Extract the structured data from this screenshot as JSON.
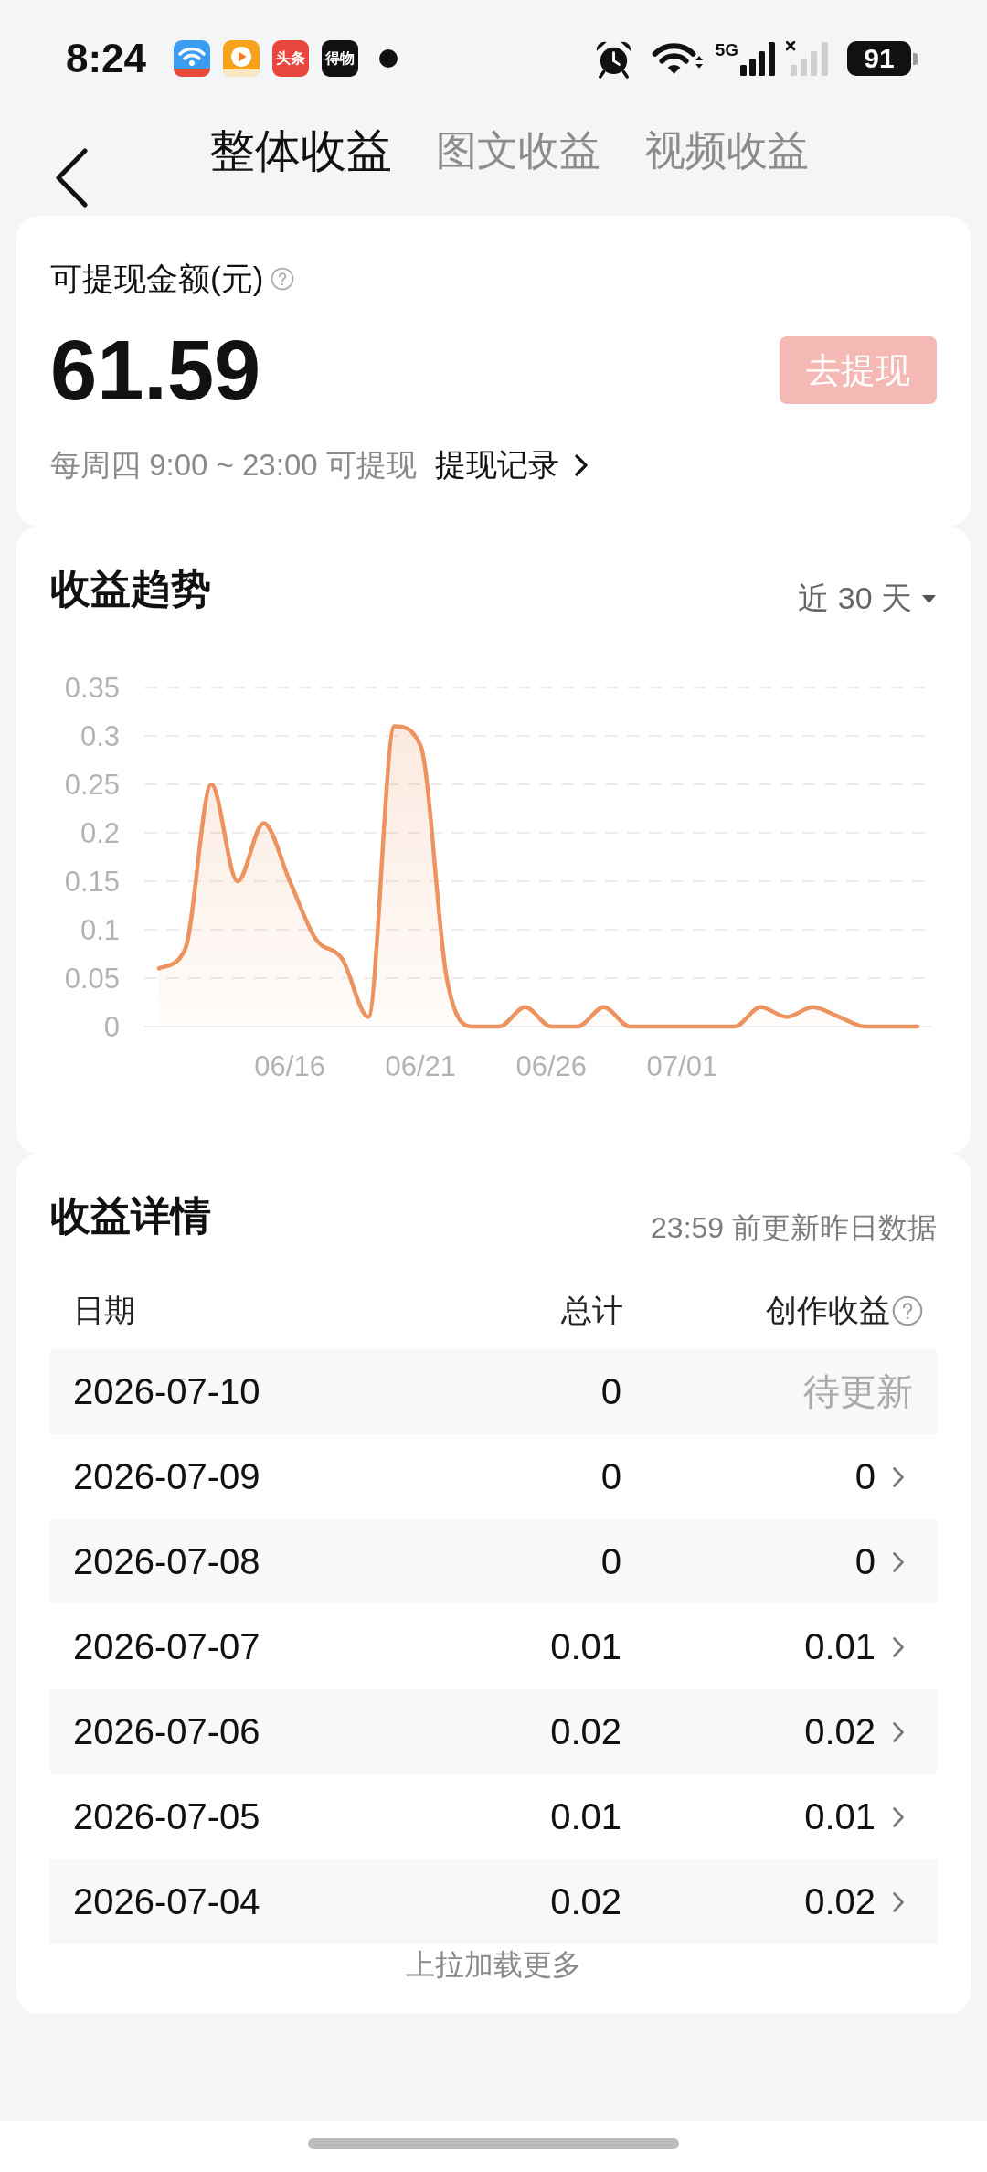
{
  "status_bar": {
    "time": "8:24",
    "app_badges": [
      {
        "label": "头条",
        "color": "#e8463d"
      },
      {
        "label": "得物",
        "color": "#111111"
      }
    ],
    "network": "5G",
    "battery": "91"
  },
  "tabs": [
    {
      "label": "整体收益",
      "selected": true
    },
    {
      "label": "图文收益",
      "selected": false
    },
    {
      "label": "视频收益",
      "selected": false
    }
  ],
  "balance_card": {
    "label": "可提现金额(元)",
    "amount": "61.59",
    "withdraw_button": {
      "label": "去提现",
      "disabled": true
    },
    "schedule": "每周四 9:00 ~ 23:00 可提现",
    "records_link": "提现记录"
  },
  "trend_card": {
    "title": "收益趋势",
    "range": "近 30 天",
    "chart_data": {
      "type": "area",
      "categories": [
        null,
        null,
        null,
        null,
        null,
        "06/16",
        null,
        null,
        null,
        null,
        "06/21",
        null,
        null,
        null,
        null,
        "06/26",
        null,
        null,
        null,
        null,
        "07/01",
        null,
        null,
        null,
        null,
        null,
        null,
        null,
        null,
        null
      ],
      "series": [
        {
          "color": "#ec935f",
          "values": [
            0.06,
            0.08,
            0.25,
            0.15,
            0.21,
            0.15,
            0.09,
            0.07,
            0.01,
            0.31,
            0.29,
            0.05,
            0,
            0,
            0.02,
            0,
            0,
            0.02,
            0,
            0,
            0,
            0,
            0,
            0.02,
            0.01,
            0.02,
            0.01,
            0,
            0,
            0
          ]
        }
      ],
      "ylim": [
        0,
        0.35
      ],
      "yticks": [
        0,
        0.05,
        0.1,
        0.15,
        0.2,
        0.25,
        0.3,
        0.35
      ],
      "grid": true
    }
  },
  "details_card": {
    "title": "收益详情",
    "note": "23:59 前更新昨日数据",
    "columns": [
      "日期",
      "总计",
      "创作收益"
    ],
    "rows": [
      {
        "date": "2026-07-10",
        "total": "0",
        "creation": "待更新",
        "pending": true
      },
      {
        "date": "2026-07-09",
        "total": "0",
        "creation": "0",
        "pending": false
      },
      {
        "date": "2026-07-08",
        "total": "0",
        "creation": "0",
        "pending": false
      },
      {
        "date": "2026-07-07",
        "total": "0.01",
        "creation": "0.01",
        "pending": false
      },
      {
        "date": "2026-07-06",
        "total": "0.02",
        "creation": "0.02",
        "pending": false
      },
      {
        "date": "2026-07-05",
        "total": "0.01",
        "creation": "0.01",
        "pending": false
      },
      {
        "date": "2026-07-04",
        "total": "0.02",
        "creation": "0.02",
        "pending": false
      }
    ],
    "footer": "上拉加载更多"
  }
}
